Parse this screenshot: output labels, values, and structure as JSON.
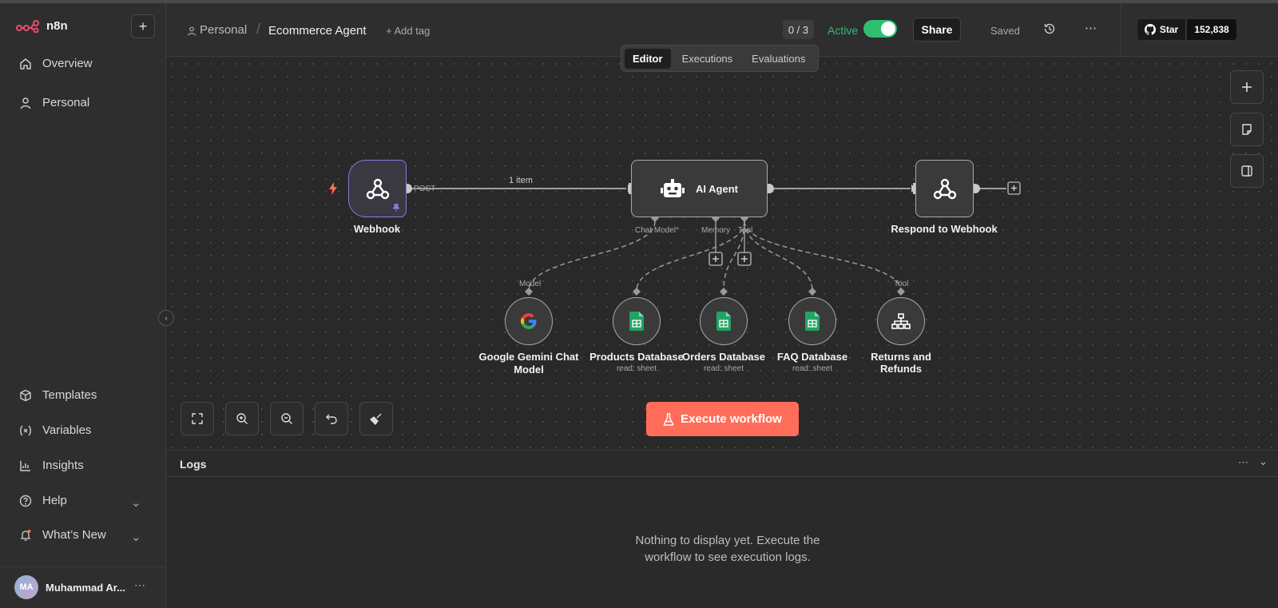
{
  "app": {
    "logo_text": "n8n"
  },
  "sidebar": {
    "items": [
      {
        "label": "Overview",
        "icon": "home-icon"
      },
      {
        "label": "Personal",
        "icon": "user-icon"
      }
    ],
    "bottom_items": [
      {
        "label": "Templates",
        "icon": "box-icon"
      },
      {
        "label": "Variables",
        "icon": "variable-icon"
      },
      {
        "label": "Insights",
        "icon": "chart-icon"
      },
      {
        "label": "Help",
        "icon": "help-icon"
      },
      {
        "label": "What’s New",
        "icon": "bell-icon"
      }
    ],
    "user": {
      "initials": "MA",
      "name": "Muhammad Ar..."
    }
  },
  "header": {
    "breadcrumb_project": "Personal",
    "workflow_name": "Ecommerce Agent",
    "add_tag": "+ Add tag",
    "counter": "0 / 3",
    "active_label": "Active",
    "active": true,
    "share": "Share",
    "saved": "Saved",
    "github": {
      "star": "Star",
      "count": "152,838"
    }
  },
  "tabs": {
    "editor": "Editor",
    "executions": "Executions",
    "evaluations": "Evaluations",
    "selected": "Editor"
  },
  "nodes": {
    "webhook": {
      "label": "Webhook",
      "method": "POST"
    },
    "edge_label": "1 item",
    "agent": {
      "label": "AI Agent",
      "ports": {
        "chat_model": "Chat Model",
        "required_mark": "*",
        "memory": "Memory",
        "tool": "Tool"
      }
    },
    "respond": {
      "label": "Respond to Webhook"
    },
    "model_port": "Model",
    "tool_port": "Tool",
    "gemini": {
      "label_line1": "Google Gemini Chat",
      "label_line2": "Model"
    },
    "products": {
      "label": "Products Database",
      "sub": "read: sheet"
    },
    "orders": {
      "label": "Orders Database",
      "sub": "read: sheet"
    },
    "faq": {
      "label": "FAQ Database",
      "sub": "read: sheet"
    },
    "returns": {
      "label": "Returns and Refunds"
    }
  },
  "execute_button": "Execute workflow",
  "logs": {
    "title": "Logs",
    "empty_line1": "Nothing to display yet. Execute the",
    "empty_line2": "workflow to see execution logs."
  },
  "colors": {
    "accent": "#ff6d5a",
    "active_green": "#2fbf71",
    "webhook_border": "#8a7ae0",
    "sheets_green": "#21a464"
  }
}
